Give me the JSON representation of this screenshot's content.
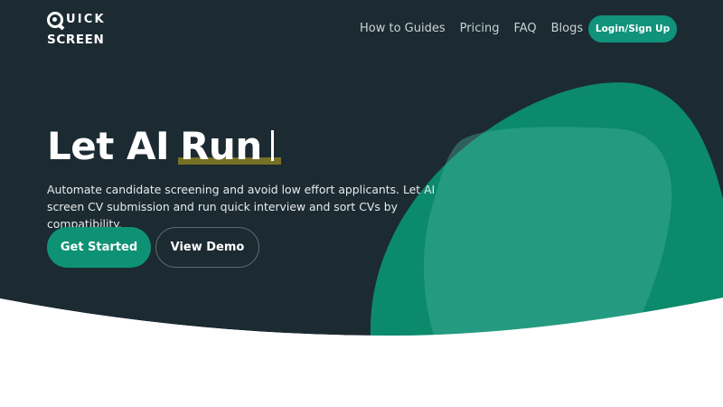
{
  "logo": {
    "word1": "UICK",
    "word2": "SCREEN"
  },
  "nav": {
    "items": [
      {
        "label": "How to Guides"
      },
      {
        "label": "Pricing"
      },
      {
        "label": "FAQ"
      },
      {
        "label": "Blogs"
      }
    ],
    "login_label": "Login/Sign Up"
  },
  "hero": {
    "headline_static": "Let AI",
    "headline_typed": "Run",
    "subtitle": "Automate candidate screening and avoid low effort applicants. Let AI screen CV submission and run quick interview and sort CVs by compatibility.",
    "primary_button": "Get Started",
    "secondary_button": "View Demo"
  },
  "colors": {
    "hero_bg": "#1c2a32",
    "accent": "#0e9275",
    "highlight": "#7c7427"
  }
}
